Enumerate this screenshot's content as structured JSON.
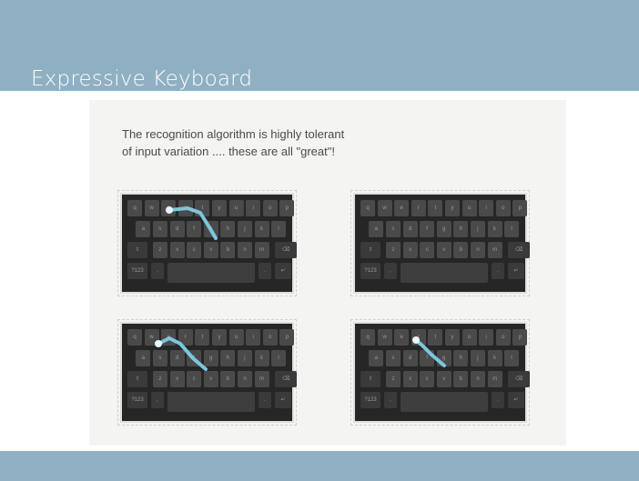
{
  "slide": {
    "title": "Expressive Keyboard",
    "caption_line1": "The recognition algorithm is highly tolerant",
    "caption_line2": "of input variation .... these are all \"great\"!"
  },
  "keyboard": {
    "row1": [
      "q",
      "w",
      "e",
      "r",
      "t",
      "y",
      "u",
      "i",
      "o",
      "p"
    ],
    "row2": [
      "a",
      "s",
      "d",
      "f",
      "g",
      "h",
      "j",
      "k",
      "l"
    ],
    "row3": [
      "z",
      "x",
      "c",
      "v",
      "b",
      "n",
      "m"
    ],
    "shift_icon": "shift-arrow",
    "delete_icon": "backspace",
    "numbers_key": "?123",
    "return_icon": "return-arrow"
  },
  "colors": {
    "band": "#8fb0c3",
    "keyboard_bg": "#262626",
    "key": "#4a4a4a",
    "swipe_trace": "#7cc6de"
  }
}
